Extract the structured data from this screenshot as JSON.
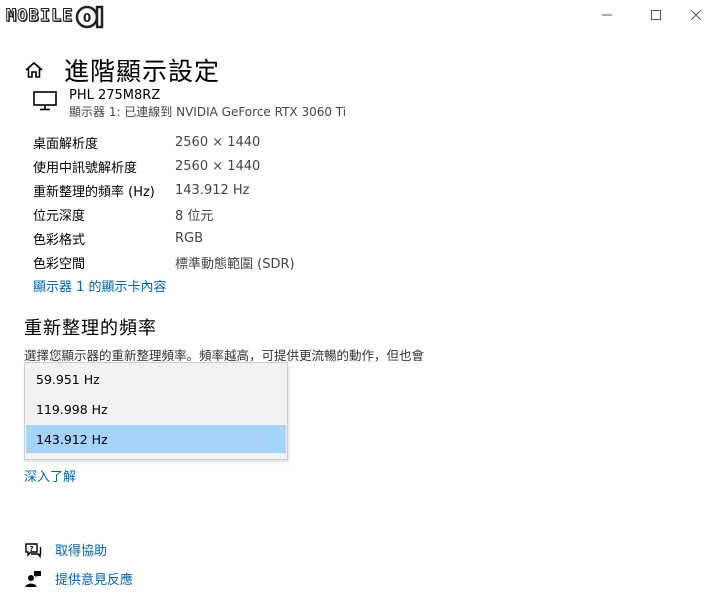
{
  "titlebar": {
    "logo_text": "MOBILE",
    "minimize_glyph": "minimize-icon",
    "maximize_glyph": "maximize-icon",
    "close_glyph": "close-icon"
  },
  "header": {
    "title": "進階顯示設定"
  },
  "monitor": {
    "name": "PHL 275M8RZ",
    "connection": "顯示器 1: 已連線到 NVIDIA GeForce RTX 3060 Ti"
  },
  "display_info": [
    {
      "label": "桌面解析度",
      "value": "2560 × 1440"
    },
    {
      "label": "使用中訊號解析度",
      "value": "2560 × 1440"
    },
    {
      "label": "重新整理的頻率 (Hz)",
      "value": "143.912 Hz"
    },
    {
      "label": "位元深度",
      "value": "8 位元"
    },
    {
      "label": "色彩格式",
      "value": "RGB"
    },
    {
      "label": "色彩空間",
      "value": "標準動態範圍 (SDR)"
    }
  ],
  "adapter_link": "顯示器 1 的顯示卡內容",
  "refresh_section": {
    "title": "重新整理的頻率",
    "description": "選擇您顯示器的重新整理頻率。頻率越高，可提供更流暢的動作，但也會",
    "options": [
      "59.951 Hz",
      "119.998 Hz",
      "143.912 Hz"
    ],
    "selected": "143.912 Hz"
  },
  "learn_more": "深入了解",
  "help_links": {
    "get_help": "取得協助",
    "feedback": "提供意見反應"
  },
  "colors": {
    "accent_link": "#0063b1",
    "selected_option": "#a6d3f8"
  }
}
